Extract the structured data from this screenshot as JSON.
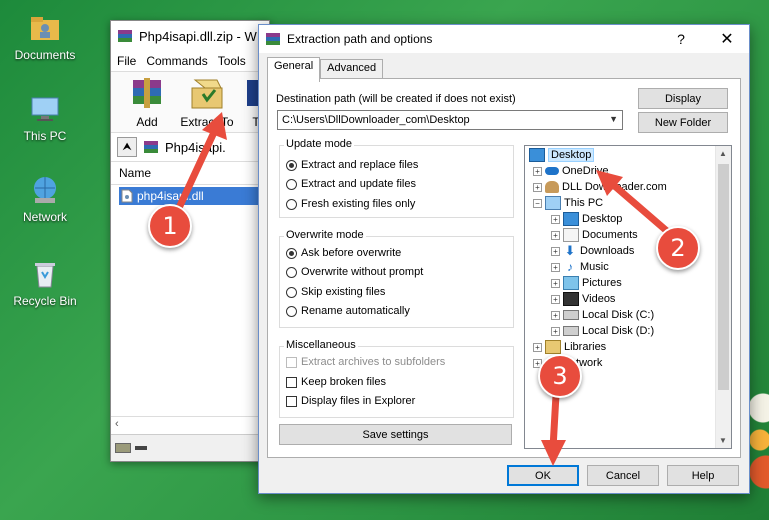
{
  "desktop": {
    "icons": [
      {
        "label": "Documents",
        "icon": "folder-user-icon"
      },
      {
        "label": "This PC",
        "icon": "computer-icon"
      },
      {
        "label": "Network",
        "icon": "network-globe-icon"
      },
      {
        "label": "Recycle Bin",
        "icon": "recycle-bin-icon"
      }
    ]
  },
  "winrar": {
    "title": "Php4isapi.dll.zip - W",
    "menu": [
      "File",
      "Commands",
      "Tools"
    ],
    "toolbar": {
      "add_label": "Add",
      "extract_label": "Extract To",
      "more_label": "T"
    },
    "address": "Php4isapi.",
    "column_name": "Name",
    "file": "php4isapi.dll"
  },
  "dialog": {
    "title": "Extraction path and options",
    "help_glyph": "?",
    "close_glyph": "✕",
    "tabs": [
      "General",
      "Advanced"
    ],
    "dest_label": "Destination path (will be created if does not exist)",
    "dest_value": "C:\\Users\\DllDownloader_com\\Desktop",
    "display_button": "Display",
    "new_folder_button": "New Folder",
    "update_mode": {
      "title": "Update mode",
      "options": [
        "Extract and replace files",
        "Extract and update files",
        "Fresh existing files only"
      ],
      "selected": 0
    },
    "overwrite_mode": {
      "title": "Overwrite mode",
      "options": [
        "Ask before overwrite",
        "Overwrite without prompt",
        "Skip existing files",
        "Rename automatically"
      ],
      "selected": 0
    },
    "misc": {
      "title": "Miscellaneous",
      "options": [
        "Extract archives to subfolders",
        "Keep broken files",
        "Display files in Explorer"
      ]
    },
    "save_settings": "Save settings",
    "tree": [
      {
        "label": "Desktop",
        "selected": true
      },
      {
        "label": "OneDrive"
      },
      {
        "label": "DLL Downloader.com"
      },
      {
        "label": "This PC"
      },
      {
        "label": "Desktop"
      },
      {
        "label": "Documents"
      },
      {
        "label": "Downloads"
      },
      {
        "label": "Music"
      },
      {
        "label": "Pictures"
      },
      {
        "label": "Videos"
      },
      {
        "label": "Local Disk (C:)"
      },
      {
        "label": "Local Disk (D:)"
      },
      {
        "label": "Libraries"
      },
      {
        "label": "Network"
      }
    ],
    "ok_button": "OK",
    "cancel_button": "Cancel",
    "help_button": "Help"
  },
  "annotations": [
    "1",
    "2",
    "3"
  ],
  "colors": {
    "accent": "#e84c3d",
    "selection": "#cce8ff",
    "desktop": "#2c9443"
  }
}
